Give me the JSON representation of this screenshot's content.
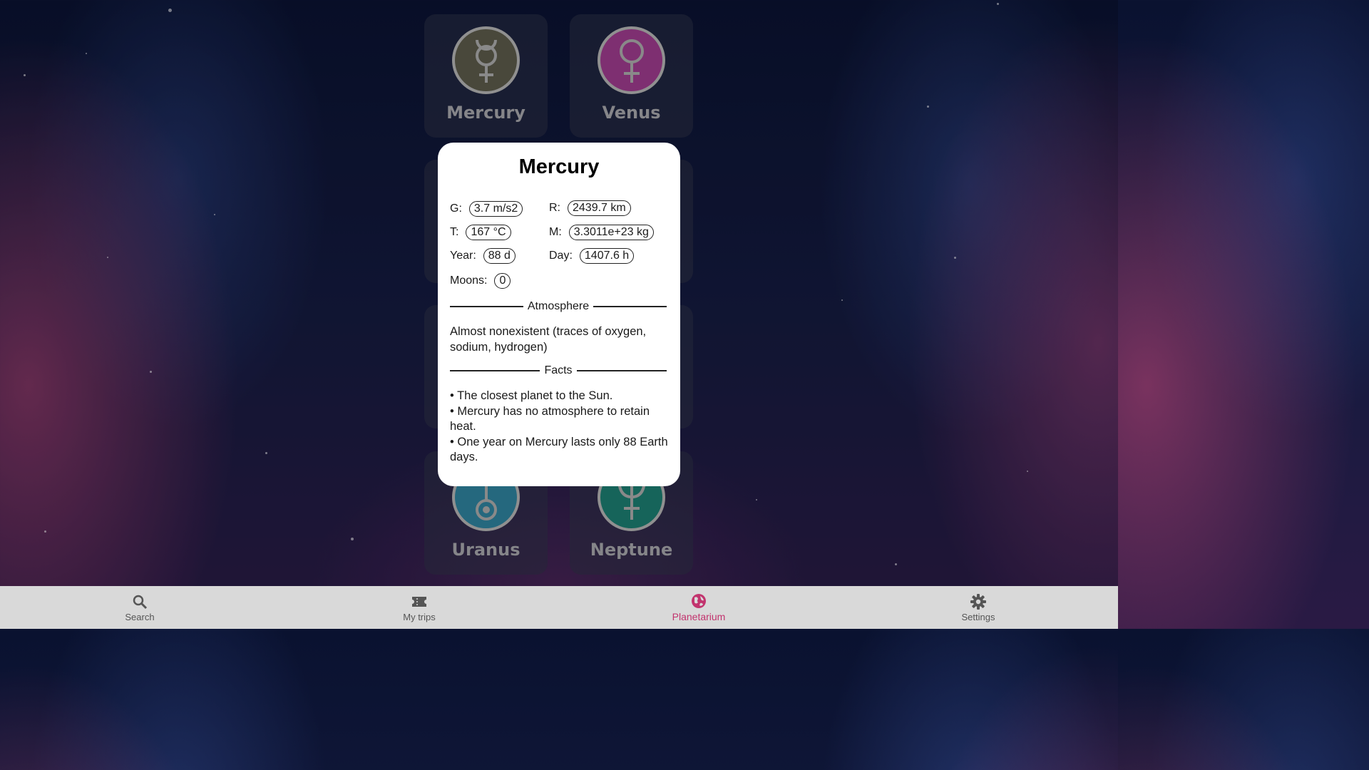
{
  "grid": {
    "planets": [
      {
        "name": "Mercury",
        "color": "#5a5849",
        "symbol": "mercury-symbol-icon"
      },
      {
        "name": "Venus",
        "color": "#9a3a8a",
        "symbol": "venus-symbol-icon"
      },
      {
        "name": "Uranus",
        "color": "#2e7f9a",
        "symbol": "uranus-symbol-icon"
      },
      {
        "name": "Neptune",
        "color": "#1c7a6e",
        "symbol": "neptune-symbol-icon"
      }
    ]
  },
  "modal": {
    "title": "Mercury",
    "stats": {
      "g_label": "G:",
      "g_value": "3.7 m/s2",
      "r_label": "R:",
      "r_value": "2439.7 km",
      "t_label": "T:",
      "t_value": "167 °C",
      "m_label": "M:",
      "m_value": "3.3011e+23 kg",
      "year_label": "Year:",
      "year_value": "88 d",
      "day_label": "Day:",
      "day_value": "1407.6 h",
      "moons_label": "Moons:",
      "moons_value": "0"
    },
    "atmosphere_heading": "Atmosphere",
    "atmosphere_text": "Almost nonexistent (traces of oxygen, sodium, hydrogen)",
    "facts_heading": "Facts",
    "facts": [
      "• The closest planet to the Sun.",
      "• Mercury has no atmosphere to retain heat.",
      "• One year on Mercury lasts only 88 Earth days."
    ]
  },
  "nav": {
    "items": [
      {
        "label": "Search",
        "icon": "search-icon"
      },
      {
        "label": "My trips",
        "icon": "ticket-icon"
      },
      {
        "label": "Planetarium",
        "icon": "globe-icon"
      },
      {
        "label": "Settings",
        "icon": "gear-icon"
      }
    ],
    "active_color": "#c2346e"
  }
}
